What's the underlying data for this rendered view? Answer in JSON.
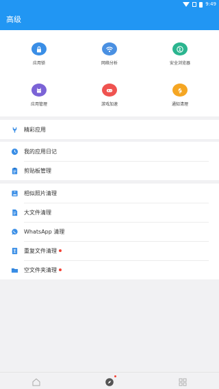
{
  "status_bar": {
    "time": "9:49"
  },
  "app_bar": {
    "title": "高级"
  },
  "grid": [
    {
      "label": "应用锁",
      "icon": "lock-icon",
      "color": "#3a8ee6"
    },
    {
      "label": "网络分析",
      "icon": "network-icon",
      "color": "#4a90e2"
    },
    {
      "label": "安全浏览器",
      "icon": "browser-icon",
      "color": "#2bb58f"
    },
    {
      "label": "应用管理",
      "icon": "app-manage-icon",
      "color": "#7b63d6"
    },
    {
      "label": "游戏加速",
      "icon": "gamepad-icon",
      "color": "#ef5350"
    },
    {
      "label": "通知清理",
      "icon": "notification-clean-icon",
      "color": "#f5a623"
    }
  ],
  "rows": {
    "featured": {
      "label": "精彩应用",
      "icon": "wrench-icon"
    },
    "app_diary": {
      "label": "我的应用日记",
      "icon": "clock-icon"
    },
    "clipboard": {
      "label": "剪贴板管理",
      "icon": "clipboard-icon"
    },
    "similar_photos": {
      "label": "相似照片清理",
      "icon": "photo-icon"
    },
    "large_files": {
      "label": "大文件清理",
      "icon": "file-icon"
    },
    "whatsapp": {
      "label": "WhatsApp 清理",
      "icon": "whatsapp-icon"
    },
    "duplicate_files": {
      "label": "重复文件清理",
      "icon": "duplicate-icon",
      "badge": true
    },
    "empty_folders": {
      "label": "空文件夹清理",
      "icon": "folder-icon",
      "badge": true
    }
  },
  "colors": {
    "primary": "#2196f3",
    "row_icon": "#3a8ee6",
    "badge": "#f44336"
  },
  "bottom_nav": [
    {
      "icon": "home-icon"
    },
    {
      "icon": "compass-icon",
      "badge": true,
      "active": true
    },
    {
      "icon": "grid-icon"
    }
  ]
}
